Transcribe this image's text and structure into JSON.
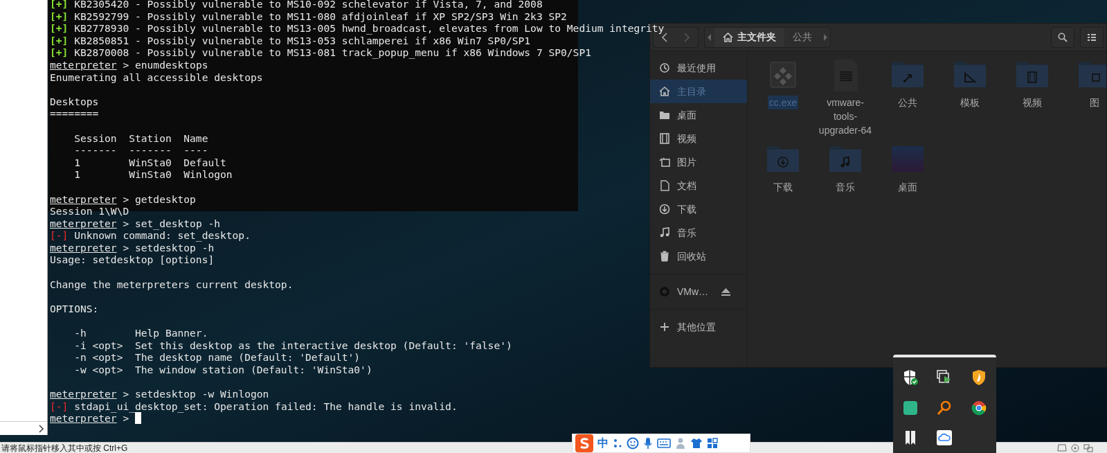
{
  "terminal": {
    "cursor_visible": true,
    "lines": [
      {
        "kind": "status",
        "mark": "[+]",
        "text": " KB2305420 - Possibly vulnerable to MS10-092 schelevator if Vista, 7, and 2008"
      },
      {
        "kind": "status",
        "mark": "[+]",
        "text": " KB2592799 - Possibly vulnerable to MS11-080 afdjoinleaf if XP SP2/SP3 Win 2k3 SP2"
      },
      {
        "kind": "status",
        "mark": "[+]",
        "text": " KB2778930 - Possibly vulnerable to MS13-005 hwnd_broadcast, elevates from Low to Medium integrity"
      },
      {
        "kind": "status",
        "mark": "[+]",
        "text": " KB2850851 - Possibly vulnerable to MS13-053 schlamperei if x86 Win7 SP0/SP1"
      },
      {
        "kind": "status",
        "mark": "[+]",
        "text": " KB2870008 - Possibly vulnerable to MS13-081 track_popup_menu if x86 Windows 7 SP0/SP1"
      },
      {
        "kind": "prompt",
        "prompt": "meterpreter",
        "text": " > enumdesktops"
      },
      {
        "kind": "output",
        "text": "Enumerating all accessible desktops"
      },
      {
        "kind": "blank"
      },
      {
        "kind": "output",
        "text": "Desktops"
      },
      {
        "kind": "output",
        "text": "========"
      },
      {
        "kind": "blank"
      },
      {
        "kind": "output",
        "text": "    Session  Station  Name"
      },
      {
        "kind": "output",
        "text": "    -------  -------  ----"
      },
      {
        "kind": "output",
        "text": "    1        WinSta0  Default"
      },
      {
        "kind": "output",
        "text": "    1        WinSta0  Winlogon"
      },
      {
        "kind": "blank"
      },
      {
        "kind": "prompt",
        "prompt": "meterpreter",
        "text": " > getdesktop"
      },
      {
        "kind": "output",
        "text": "Session 1\\W\\D"
      },
      {
        "kind": "prompt",
        "prompt": "meterpreter",
        "text": " > set_desktop -h"
      },
      {
        "kind": "error",
        "mark": "[-]",
        "text": " Unknown command: set_desktop."
      },
      {
        "kind": "prompt",
        "prompt": "meterpreter",
        "text": " > setdesktop -h"
      },
      {
        "kind": "output",
        "text": "Usage: setdesktop [options]"
      },
      {
        "kind": "blank"
      },
      {
        "kind": "output",
        "text": "Change the meterpreters current desktop."
      },
      {
        "kind": "blank"
      },
      {
        "kind": "output",
        "text": "OPTIONS:"
      },
      {
        "kind": "blank"
      },
      {
        "kind": "output",
        "text": "    -h        Help Banner."
      },
      {
        "kind": "output",
        "text": "    -i <opt>  Set this desktop as the interactive desktop (Default: 'false')"
      },
      {
        "kind": "output",
        "text": "    -n <opt>  The desktop name (Default: 'Default')"
      },
      {
        "kind": "output",
        "text": "    -w <opt>  The window station (Default: 'WinSta0')"
      },
      {
        "kind": "blank"
      },
      {
        "kind": "prompt",
        "prompt": "meterpreter",
        "text": " > setdesktop -w Winlogon"
      },
      {
        "kind": "error",
        "mark": "[-]",
        "text": " stdapi_ui_desktop_set: Operation failed: The handle is invalid."
      },
      {
        "kind": "prompt",
        "prompt": "meterpreter",
        "text": " > "
      }
    ]
  },
  "file_manager": {
    "path": [
      {
        "label": "主文件夹",
        "selected": true
      },
      {
        "label": "公共",
        "selected": false
      }
    ],
    "sidebar": [
      {
        "label": "最近使用",
        "selected": false
      },
      {
        "label": "主目录",
        "selected": true
      },
      {
        "label": "桌面",
        "selected": false
      },
      {
        "label": "视频",
        "selected": false
      },
      {
        "label": "图片",
        "selected": false
      },
      {
        "label": "文档",
        "selected": false
      },
      {
        "label": "下载",
        "selected": false
      },
      {
        "label": "音乐",
        "selected": false
      },
      {
        "label": "回收站",
        "selected": false
      },
      {
        "label": "VMw…",
        "selected": false
      },
      {
        "label": "其他位置",
        "selected": false
      }
    ],
    "files": [
      {
        "kind": "executable",
        "label": "cc.exe",
        "selected": true
      },
      {
        "kind": "document",
        "label": "vmware-tools-upgrader-64",
        "selected": false
      },
      {
        "kind": "folder",
        "label": "公共",
        "selected": false
      },
      {
        "kind": "folder",
        "label": "模板",
        "selected": false
      },
      {
        "kind": "folder",
        "label": "视频",
        "selected": false
      },
      {
        "kind": "folder",
        "label": "图",
        "selected": false
      },
      {
        "kind": "folder",
        "label": "下载",
        "selected": false
      },
      {
        "kind": "folder",
        "label": "音乐",
        "selected": false
      },
      {
        "kind": "image",
        "label": "桌面",
        "selected": false
      }
    ]
  },
  "ime_toolbar": {
    "mode": "中"
  },
  "status_bar": {
    "hint": "请将鼠标指针移入其中或按 Ctrl+G"
  }
}
